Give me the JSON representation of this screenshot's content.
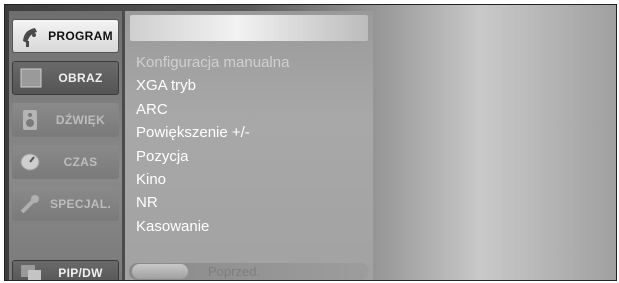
{
  "sidebar": {
    "items": [
      {
        "label": "PROGRAM",
        "icon": "satellite-dish-icon",
        "state": "active"
      },
      {
        "label": "OBRAZ",
        "icon": "picture-icon",
        "state": "normal"
      },
      {
        "label": "DŹWIĘK",
        "icon": "speaker-icon",
        "state": "dim"
      },
      {
        "label": "CZAS",
        "icon": "clock-icon",
        "state": "dim"
      },
      {
        "label": "SPECJAL.",
        "icon": "key-icon",
        "state": "dim"
      },
      {
        "label": "PIP/DW",
        "icon": "pip-window-icon",
        "state": "normal"
      }
    ]
  },
  "menu": {
    "items": [
      "Konfiguracja manualna",
      "XGA tryb",
      "ARC",
      "Powiększenie +/-",
      "Pozycja",
      "Kino",
      "NR",
      "Kasowanie"
    ]
  },
  "footer": {
    "label": "Poprzed."
  }
}
